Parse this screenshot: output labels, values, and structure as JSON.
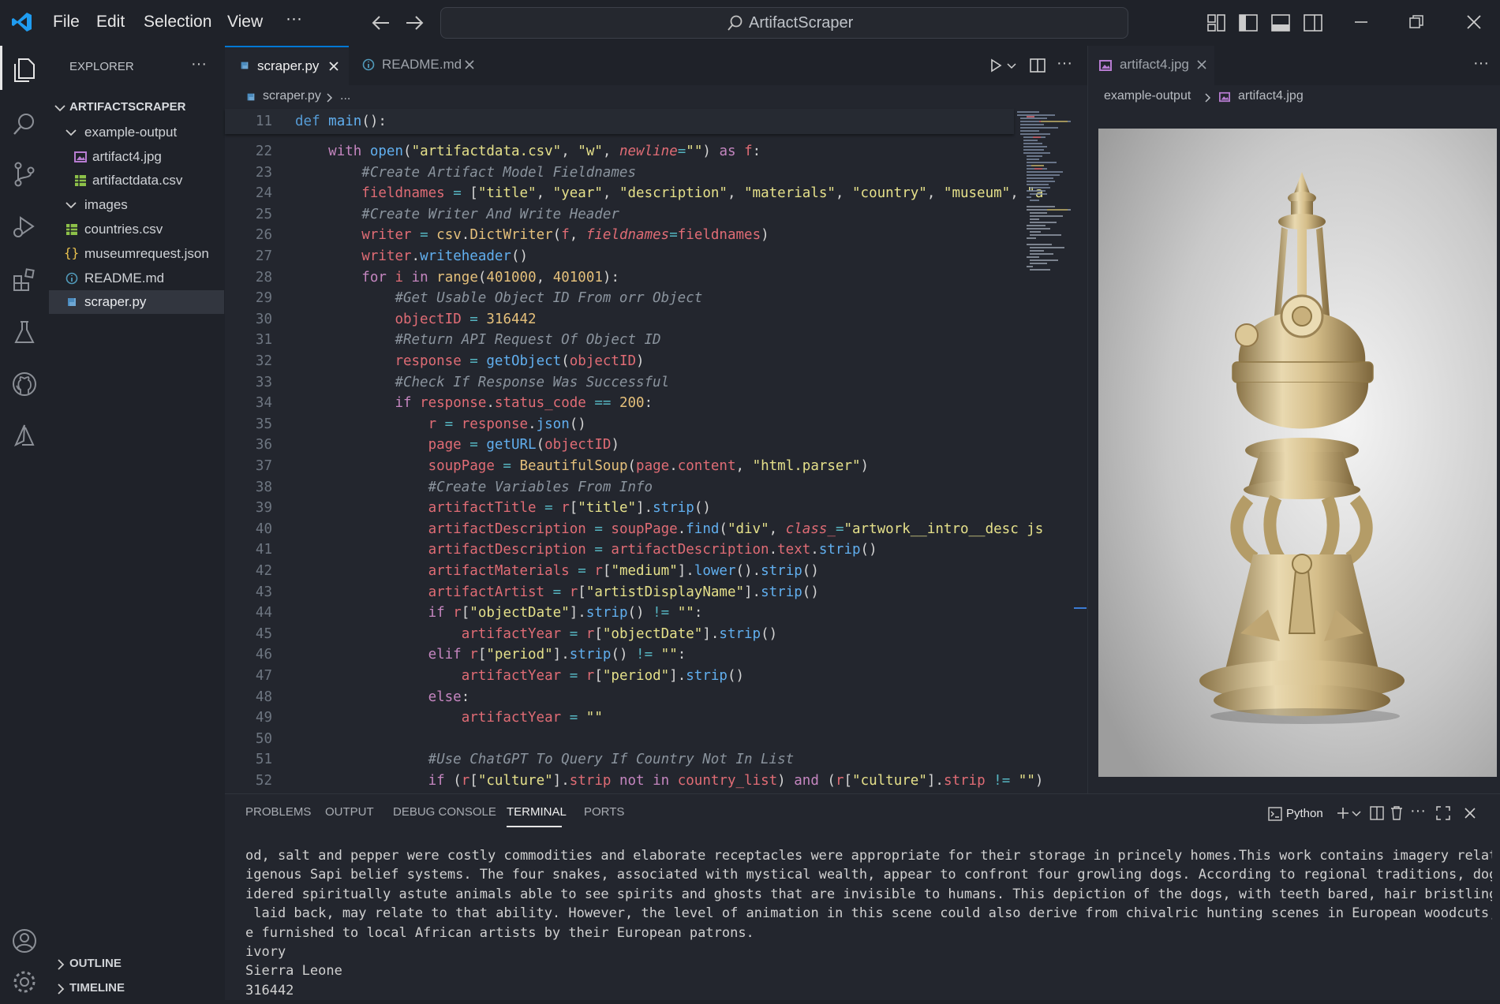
{
  "window": {
    "menu": [
      "File",
      "Edit",
      "Selection",
      "View"
    ],
    "menu_more": "···",
    "search_text": "ArtifactScraper"
  },
  "explorer": {
    "title": "EXPLORER",
    "project": "ARTIFACTSCRAPER",
    "tree": [
      {
        "label": "example-output",
        "kind": "folder"
      },
      {
        "label": "artifact4.jpg",
        "kind": "image"
      },
      {
        "label": "artifactdata.csv",
        "kind": "csv"
      },
      {
        "label": "images",
        "kind": "folder"
      },
      {
        "label": "countries.csv",
        "kind": "csv"
      },
      {
        "label": "museumrequest.json",
        "kind": "json"
      },
      {
        "label": "README.md",
        "kind": "info"
      },
      {
        "label": "scraper.py",
        "kind": "python",
        "selected": true
      }
    ],
    "outline": "OUTLINE",
    "timeline": "TIMELINE"
  },
  "editor": {
    "tabs": [
      {
        "label": "scraper.py",
        "active": true
      },
      {
        "label": "README.md",
        "active": false
      }
    ],
    "breadcrumb": {
      "file": "scraper.py",
      "rest": "..."
    },
    "line_numbers": [
      "11",
      "22",
      "23",
      "24",
      "25",
      "26",
      "27",
      "28",
      "29",
      "30",
      "31",
      "32",
      "33",
      "34",
      "35",
      "36",
      "37",
      "38",
      "39",
      "40",
      "41",
      "42",
      "43",
      "44",
      "45",
      "46",
      "47",
      "48",
      "49",
      "50",
      "51",
      "52"
    ]
  },
  "preview": {
    "tab_label": "artifact4.jpg",
    "breadcrumb_folder": "example-output",
    "breadcrumb_file": "artifact4.jpg"
  },
  "panel": {
    "tabs": [
      "PROBLEMS",
      "OUTPUT",
      "DEBUG CONSOLE",
      "TERMINAL",
      "PORTS"
    ],
    "active_tab": "TERMINAL",
    "terminal_label": "Python",
    "terminal_lines": [
      "od, salt and pepper were costly commodities and elaborate receptacles were appropriate for their storage in princely homes.This work contains imagery relating to",
      "igenous Sapi belief systems. The four snakes, associated with mystical wealth, appear to confront four growling dogs. According to regional traditions, dogs are",
      "idered spiritually astute animals able to see spirits and ghosts that are invisible to humans. This depiction of the dogs, with teeth bared, hair bristling, and",
      " laid back, may relate to that ability. However, the level of animation in this scene could also derive from chivalric hunting scenes in European woodcuts, which",
      "e furnished to local African artists by their European patrons.",
      "ivory",
      "Sierra Leone",
      "316442"
    ]
  },
  "colors": {
    "background": "#1f2229",
    "editor": "#23262e",
    "accent": "#0078d4",
    "keyword": "#c586c0",
    "function": "#61afef",
    "string": "#e5e08a",
    "comment": "#8b949e",
    "variable": "#e06c75"
  }
}
